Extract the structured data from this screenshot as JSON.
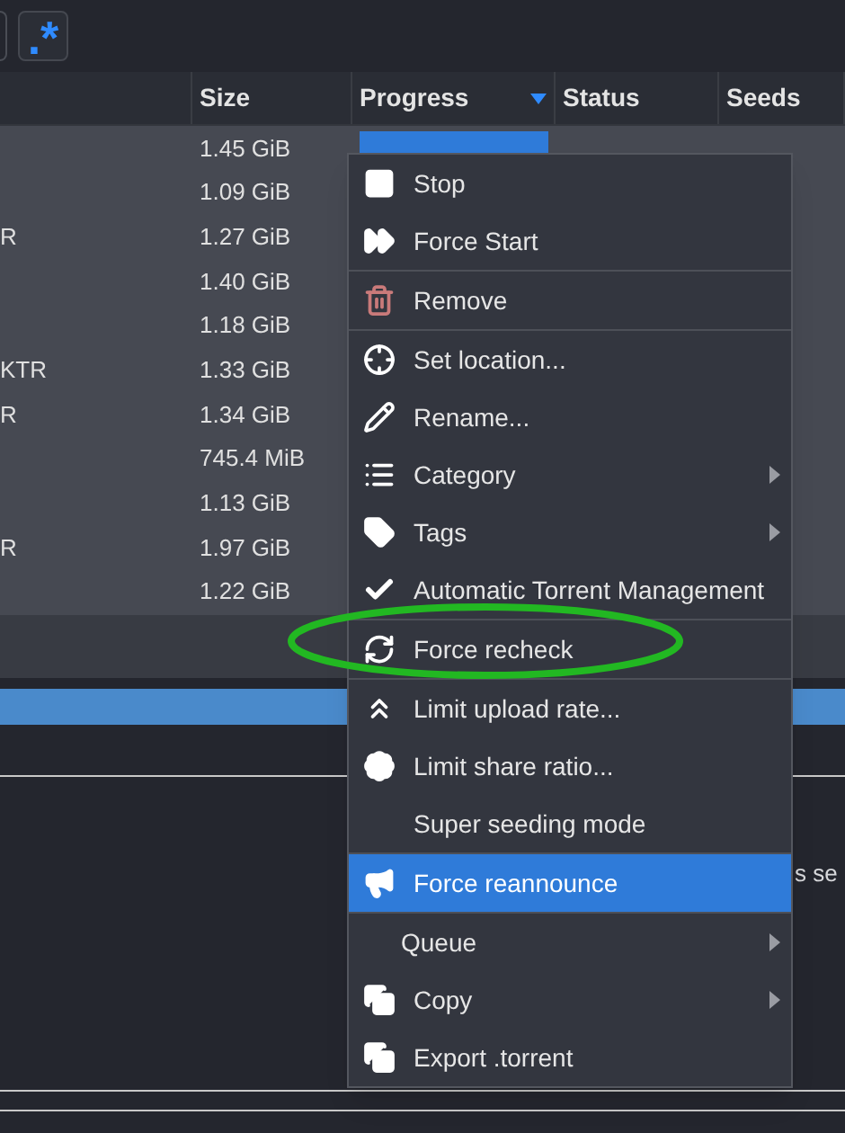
{
  "toolbar": {
    "regex_button": ".*"
  },
  "table": {
    "columns": [
      {
        "label": "Size",
        "sorted": false
      },
      {
        "label": "Progress",
        "sorted": true
      },
      {
        "label": "Status",
        "sorted": false
      },
      {
        "label": "Seeds",
        "sorted": false
      }
    ],
    "rows": [
      {
        "size": "1.45 GiB",
        "level": 1
      },
      {
        "size": "1.09 GiB"
      },
      {
        "name": "R",
        "size": "1.27 GiB"
      },
      {
        "size": "1.40 GiB"
      },
      {
        "size": "1.18 GiB"
      },
      {
        "name": "KTR",
        "size": "1.33 GiB"
      },
      {
        "name": "R",
        "size": "1.34 GiB"
      },
      {
        "size": "745.4 MiB"
      },
      {
        "size": "1.13 GiB"
      },
      {
        "name": "R",
        "size": "1.97 GiB"
      },
      {
        "size": "1.22 GiB"
      }
    ]
  },
  "details_text": "s se",
  "context_menu": {
    "groups": [
      [
        {
          "label": "Stop",
          "kind": "action",
          "submenu": false,
          "selected": false
        },
        {
          "label": "Force Start",
          "kind": "action",
          "submenu": false,
          "selected": false
        }
      ],
      [
        {
          "label": "Remove",
          "kind": "action",
          "submenu": false,
          "selected": false
        }
      ],
      [
        {
          "label": "Set location...",
          "kind": "action",
          "submenu": false,
          "selected": false
        },
        {
          "label": "Rename...",
          "kind": "action",
          "submenu": false,
          "selected": false
        },
        {
          "label": "Category",
          "kind": "action",
          "submenu": true,
          "selected": false
        },
        {
          "label": "Tags",
          "kind": "action",
          "submenu": true,
          "selected": false
        },
        {
          "label": "Automatic Torrent Management",
          "kind": "toggle",
          "checked": true,
          "submenu": false,
          "selected": false
        }
      ],
      [
        {
          "label": "Force recheck",
          "kind": "action",
          "submenu": false,
          "selected": false
        }
      ],
      [
        {
          "label": "Limit upload rate...",
          "kind": "action",
          "submenu": false,
          "selected": false
        },
        {
          "label": "Limit share ratio...",
          "kind": "action",
          "submenu": false,
          "selected": false
        },
        {
          "label": "Super seeding mode",
          "kind": "toggle",
          "checked": false,
          "submenu": false,
          "selected": false
        }
      ],
      [
        {
          "label": "Force reannounce",
          "kind": "action",
          "submenu": false,
          "selected": true
        }
      ],
      [
        {
          "label": "Queue",
          "kind": "plain",
          "submenu": true,
          "selected": false
        },
        {
          "label": "Copy",
          "kind": "action",
          "submenu": true,
          "selected": false
        },
        {
          "label": "Export .torrent",
          "kind": "action",
          "submenu": false,
          "selected": false
        }
      ]
    ]
  }
}
